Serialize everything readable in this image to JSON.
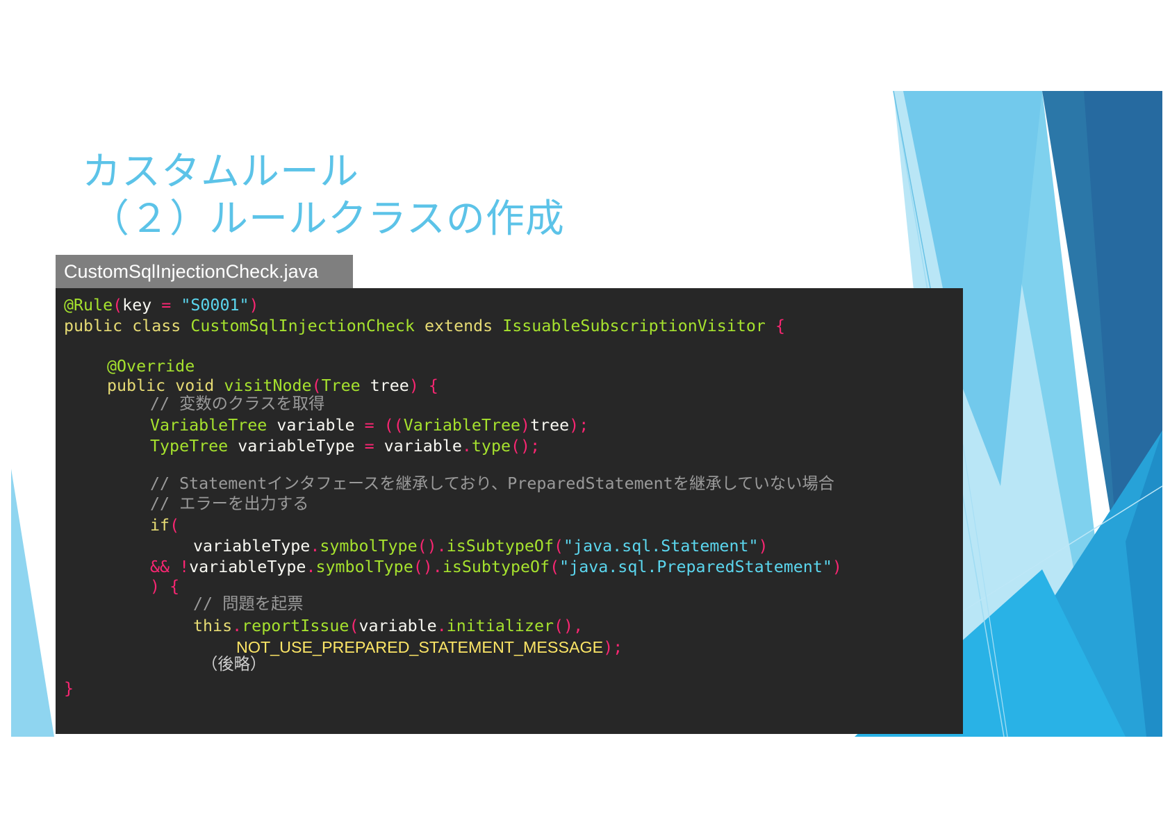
{
  "slide": {
    "title_line1": "カスタムルール",
    "title_line2": "（２）ルールクラスの作成",
    "accent_color": "#5cc3e8"
  },
  "file_tab": {
    "label": "CustomSqlInjectionCheck.java"
  },
  "code": {
    "annotation_rule": "@Rule",
    "key_ident": "key",
    "rule_key": "\"S0001\"",
    "public": "public",
    "class": "class",
    "class_name": "CustomSqlInjectionCheck",
    "extends": "extends",
    "super_class": "IssuableSubscriptionVisitor",
    "annotation_override": "@Override",
    "void": "void",
    "method_name": "visitNode",
    "param_type": "Tree",
    "param_name": "tree",
    "comment_get_class": "// 変数のクラスを取得",
    "variable_tree_type": "VariableTree",
    "variable_name": "variable",
    "type_tree_type": "TypeTree",
    "variable_type_name": "variableType",
    "type_method": "type",
    "comment_condition_1": "// Statementインタフェースを継承しており、PreparedStatementを継承していない場合",
    "comment_condition_2": "// エラーを出力する",
    "if_keyword": "if",
    "symbol_type_method": "symbolType",
    "is_subtype_method": "isSubtypeOf",
    "statement_class": "\"java.sql.Statement\"",
    "prepared_statement_class": "\"java.sql.PreparedStatement\"",
    "and_operator": "&&",
    "not_operator": "!",
    "comment_report_issue": "// 問題を起票",
    "this_keyword": "this",
    "report_issue_method": "reportIssue",
    "initializer_method": "initializer",
    "message_constant": "NOT_USE_PREPARED_STATEMENT_MESSAGE",
    "omitted_note": "（後略）",
    "closing_brace": "}"
  },
  "colors": {
    "code_background": "#272727",
    "tab_background": "#7f7f7f",
    "keyword": "#e6db74",
    "type": "#a6e22e",
    "operator": "#f92672",
    "string": "#5bd6ee",
    "comment": "#9a9a9a"
  }
}
